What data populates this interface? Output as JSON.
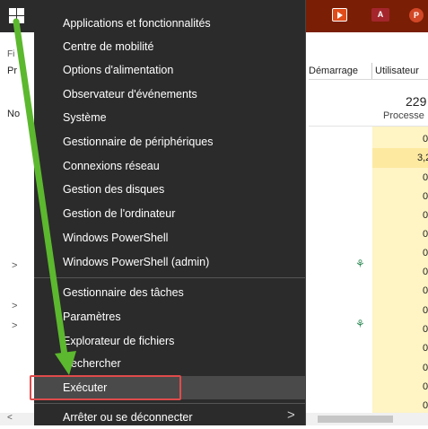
{
  "task_manager": {
    "menu_fragment_fi": "Fi",
    "tab_fragment_pr": "Pr",
    "column_fragment_no": "No",
    "tabs": [
      "Démarrage",
      "Utilisateur"
    ],
    "cpu_percent": "229",
    "cpu_label": "Processe",
    "cpu_values": [
      "0",
      "3,2",
      "0",
      "0",
      "0",
      "0",
      "0",
      "0",
      "0",
      "0",
      "0",
      "0",
      "0",
      "0",
      "0"
    ],
    "scroll_left_arrow": "<",
    "taskbar_icons": [
      "video-editor-icon",
      "access-icon",
      "powerpoint-icon"
    ],
    "access_icon_label": "A",
    "ppt_icon_label": "P"
  },
  "winx_menu": {
    "groups": [
      [
        "Applications et fonctionnalités",
        "Centre de mobilité",
        "Options d'alimentation",
        "Observateur d'événements",
        "Système",
        "Gestionnaire de périphériques",
        "Connexions réseau",
        "Gestion des disques",
        "Gestion de l'ordinateur",
        "Windows PowerShell",
        "Windows PowerShell (admin)"
      ],
      [
        "Gestionnaire des tâches",
        "Paramètres",
        "Explorateur de fichiers",
        "Rechercher",
        "Exécuter"
      ],
      [
        "Arrêter ou se déconnecter"
      ]
    ],
    "submenu_chevron": ">",
    "highlighted_item": "Exécuter",
    "colors": {
      "menu_bg": "#2b2b2b",
      "highlight_border": "#e04b4b",
      "arrow": "#5cb82e",
      "titlebar": "#7a1e06"
    }
  }
}
